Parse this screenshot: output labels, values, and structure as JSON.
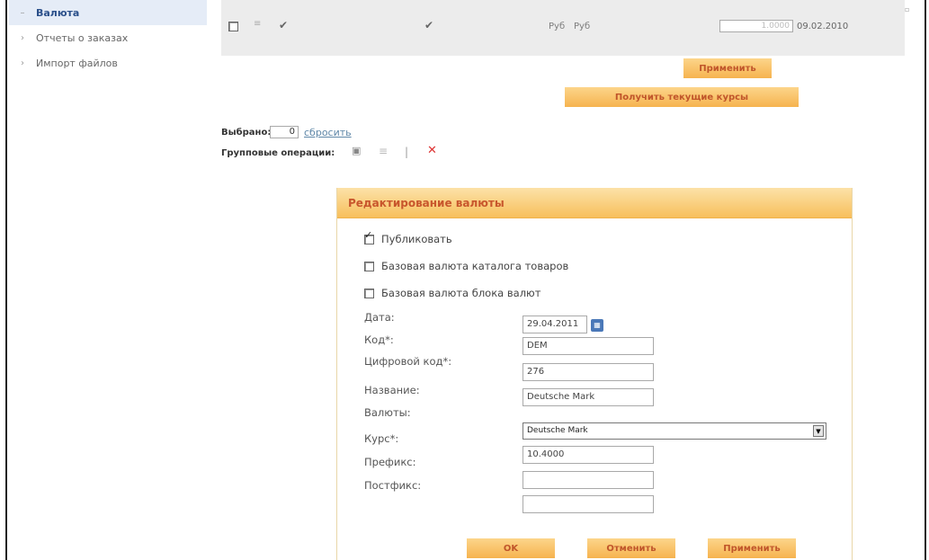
{
  "sidebar": {
    "items": [
      {
        "label": "Валюта",
        "bullet": "–"
      },
      {
        "label": "Отчеты о заказах",
        "bullet": "›"
      },
      {
        "label": "Импорт файлов",
        "bullet": "›"
      }
    ]
  },
  "table_row": {
    "from_currency": "Руб",
    "to_currency": "Руб",
    "rate": "1.0000",
    "date": "09.02.2010"
  },
  "actions": {
    "apply": "Применить",
    "get_rates": "Получить текущие курсы"
  },
  "selection": {
    "label": "Выбрано:",
    "count": "0",
    "reset": "сбросить",
    "group_ops_label": "Групповые операции:"
  },
  "dialog": {
    "title": "Редактирование валюты",
    "checkboxes": [
      {
        "label": "Публиковать",
        "checked": true
      },
      {
        "label": "Базовая валюта каталога товаров",
        "checked": false
      },
      {
        "label": "Базовая валюта блока валют",
        "checked": false
      }
    ],
    "fields": {
      "date": {
        "label": "Дата:",
        "value": "29.04.2011"
      },
      "code": {
        "label": "Код*:",
        "value": "DEM"
      },
      "numeric_code": {
        "label": "Цифровой код*:",
        "value": "276"
      },
      "name": {
        "label": "Название:",
        "value": "Deutsche Mark"
      },
      "currencies": {
        "label": "Валюты:",
        "value": "Deutsche Mark"
      },
      "rate": {
        "label": "Курс*:",
        "value": "10.4000"
      },
      "prefix": {
        "label": "Префикс:",
        "value": ""
      },
      "postfix": {
        "label": "Постфикс:",
        "value": ""
      }
    },
    "buttons": {
      "ok": "OK",
      "cancel": "Отменить",
      "apply": "Применить"
    }
  },
  "colors": {
    "accent_orange": "#f6b34f",
    "header_text": "#c8562c",
    "active_sidebar_bg": "#e5ecf7",
    "link": "#5f87a8"
  }
}
